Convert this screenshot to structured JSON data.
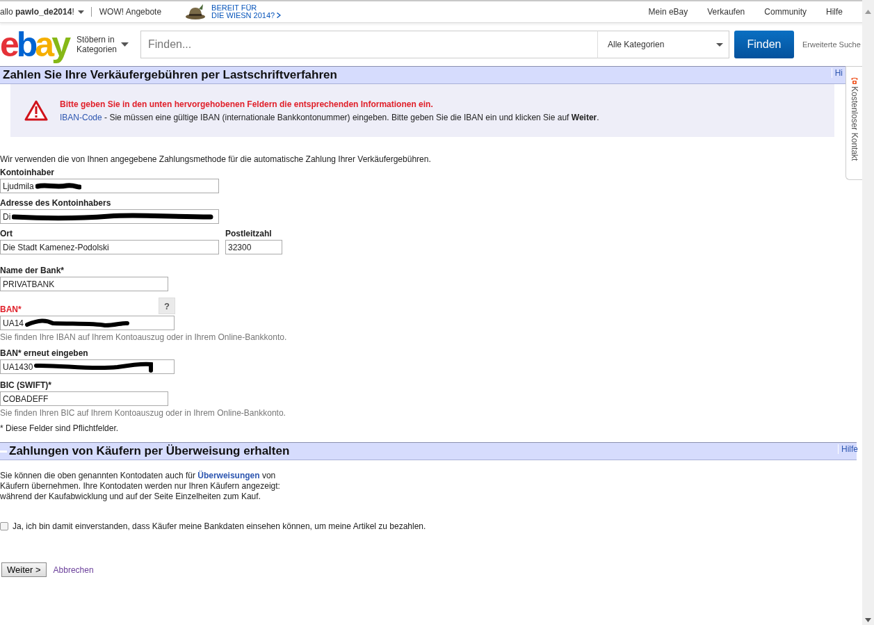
{
  "top_bar": {
    "greeting": "allo **pawlo_de2014**!",
    "deals": "WOW! Angebote",
    "promo": [
      "BEREIT FÜR",
      "DIE WIESN 2014?"
    ],
    "nav": [
      "Mein eBay",
      "Verkaufen",
      "Community",
      "Hilfe"
    ]
  },
  "header": {
    "logo": "ebay",
    "browse": [
      "Stöbern in",
      "Kategorien"
    ],
    "search": {
      "placeholder": "Finden..."
    },
    "category": "Alle Kategorien",
    "search_button": "Finden",
    "advanced": "Erweiterte Suche"
  },
  "section1": {
    "title": "Zahlen Sie Ihre Verkäufergebühren per Lastschriftverfahren",
    "help": "Hi"
  },
  "error": {
    "heading": "Bitte geben Sie in den unten hervorgehobenen Feldern die entsprechenden Informationen ein.",
    "link": "IBAN-Code",
    "message": "- Sie müssen eine gültige IBAN (internationale Bankkontonummer) eingeben. Bitte geben Sie die IBAN ein und klicken Sie auf **Weiter**."
  },
  "intro": "Wir verwenden die von Ihnen angegebene Zahlungsmethode für die automatische Zahlung Ihrer Verkäufergebühren.",
  "holder": {
    "label": "Kontoinhaber",
    "value": "Ljudmila",
    "redacted": true
  },
  "address": {
    "label": "Adresse des Kontoinhabers",
    "value": "Di",
    "redacted": true
  },
  "city": {
    "label": "Ort",
    "value": "Die Stadt Kamenez-Podolski"
  },
  "zip": {
    "label": "Postleitzahl",
    "value": "32300"
  },
  "bank": {
    "label": "Name der Bank*",
    "value": "PRIVATBANK"
  },
  "iban": {
    "label": "BAN*",
    "value": "UA14",
    "redacted": true,
    "error": true,
    "help_button": "?",
    "hint": "Sie finden Ihre IBAN auf Ihrem Kontoauszug oder in Ihrem Online-Bankkonto."
  },
  "iban_repeat": {
    "label": "BAN* erneut eingeben",
    "value": "UA1430",
    "redacted": true
  },
  "bic": {
    "label": "BIC (SWIFT)*",
    "value": "COBADEFF",
    "hint": "Sie finden Ihren BIC auf Ihrem Kontoauszug oder in Ihrem Online-Bankkonto."
  },
  "required_note": "* Diese Felder sind Pflichtfelder.",
  "section2": {
    "title": "Zahlungen von Käufern per Überweisung erhalten",
    "help": "Hilfe"
  },
  "transfer": {
    "before": "Sie können die oben genannten Kontodaten auch für",
    "link": "Überweisungen",
    "after": "von Käufern übernehmen. Ihre Kontodaten werden nur Ihren Käufern angezeigt: während der Kaufabwicklung und auf der Seite Einzelheiten zum Kauf."
  },
  "consent": {
    "label": "Ja, ich bin damit einverstanden, dass Käufer meine Bankdaten einsehen können, um meine Artikel zu bezahlen.",
    "checked": false
  },
  "actions": {
    "next": "Weiter >",
    "cancel": "Abbrechen"
  },
  "contact_tab": "Kostenloser Kontakt"
}
